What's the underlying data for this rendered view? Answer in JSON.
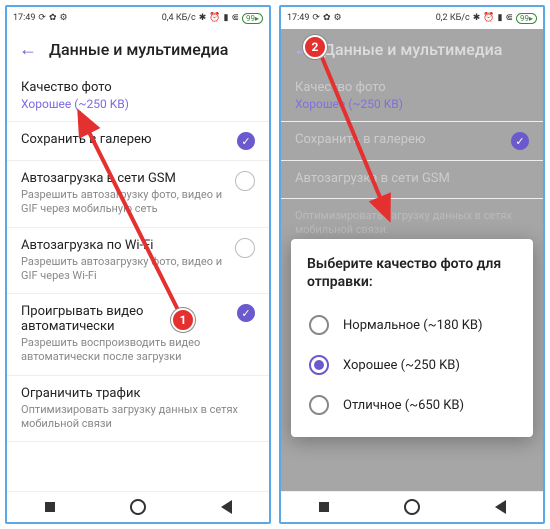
{
  "status": {
    "time": "17:49",
    "net1": "0,4 КБ/с",
    "net2": "0,2 КБ/с",
    "battery": "99"
  },
  "header": {
    "title": "Данные и мультимедиа"
  },
  "rows": {
    "quality": {
      "title": "Качество фото",
      "value": "Хорошее (~250 KB)"
    },
    "gallery": {
      "title": "Сохранить в галерею"
    },
    "gsm": {
      "title": "Автозагрузка в сети GSM",
      "sub": "Разрешить автозагрузку фото, видео и GIF через мобильную сеть"
    },
    "wifi": {
      "title": "Автозагрузка по Wi-Fi",
      "sub": "Разрешить автозагрузку фото, видео и GIF через Wi-Fi"
    },
    "autoplay": {
      "title": "Проигрывать видео автоматически",
      "sub": "Разрешить воспроизводить видео автоматически после загрузки"
    },
    "traffic": {
      "title": "Ограничить трафик",
      "sub": "Оптимизировать загрузку данных в сетях мобильной связи"
    },
    "traffic2": {
      "sub": "Оптимизировать загрузку данных в сетях мобильной связи."
    }
  },
  "dialog": {
    "title": "Выберите качество фото для отправки:",
    "options": [
      {
        "label": "Нормальное (~180 KB)",
        "selected": false
      },
      {
        "label": "Хорошее (~250 KB)",
        "selected": true
      },
      {
        "label": "Отличное (~650 KB)",
        "selected": false
      }
    ]
  },
  "badges": {
    "b1": "1",
    "b2": "2"
  }
}
